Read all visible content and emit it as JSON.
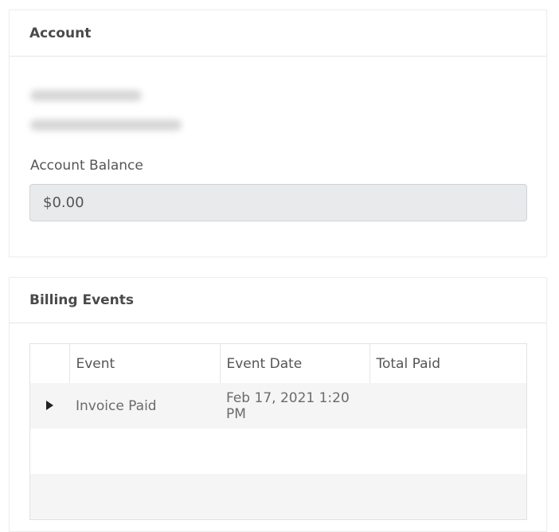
{
  "account": {
    "title": "Account",
    "balance_label": "Account Balance",
    "balance_value": "$0.00"
  },
  "billing": {
    "title": "Billing Events",
    "columns": [
      "Event",
      "Event Date",
      "Total Paid"
    ],
    "rows": [
      {
        "event": "Invoice Paid",
        "date": "Feb 17, 2021 1:20 PM",
        "total": ""
      }
    ]
  },
  "colors": {
    "field_bg": "#e9eaec",
    "stripe_bg": "#f5f5f5",
    "text": "#555555"
  }
}
